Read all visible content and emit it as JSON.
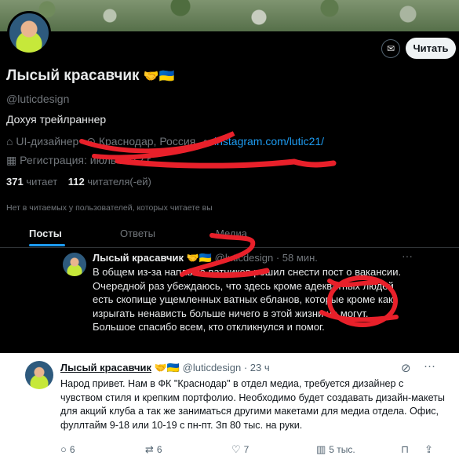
{
  "profile": {
    "name": "Лысый красавчик",
    "name_emoji": "🤝🇺🇦",
    "handle": "@luticdesign",
    "bio": "Дохуя трейлраннер",
    "profession": "UI-дизайнер",
    "location": "Краснодар, Россия",
    "link": "instagram.com/lutic21/",
    "registration": "Регистрация: июль 2012 г.",
    "following_count": "371",
    "following_label": "читает",
    "followers_count": "112",
    "followers_label": "читателя(-ей)",
    "no_mutuals_note": "Нет в читаемых у пользователей, которых читаете вы",
    "read_button": "Читать",
    "mail_icon": "mail-icon"
  },
  "tabs": [
    {
      "label": "Посты",
      "active": true
    },
    {
      "label": "Ответы",
      "active": false
    },
    {
      "label": "Медиа",
      "active": false
    }
  ],
  "dark_tweet": {
    "name": "Лысый красавчик",
    "emoji": "🤝🇺🇦",
    "handle_time": "@luticdesign · 58 мин.",
    "dots": "···",
    "text": "В общем из-за наплыва ватников решил снести пост о вакансии. Очередной раз убеждаюсь, что здесь кроме адекватных людей есть скопище ущемленных ватных ебланов, которые кроме как изрыгать ненависть больше ничего в этой жизни не могут. Большое спасибо всем, кто откликнулся и помог."
  },
  "light_tweet": {
    "name": "Лысый красавчик",
    "emoji": "🤝🇺🇦",
    "handle_time": "@luticdesign · 23 ч",
    "text": "Народ привет. Нам в ФК \"Краснодар\" в отдел медиа, требуется дизайнер с чувством стиля и крепким портфолио. Необходимо будет создавать дизайн-макеты для акций клуба а так же заниматься другими макетами для медиа отдела. Офис, фуллтайм 9-18 или 10-19 с пн-пт. Зп 80 тыс. на руки.",
    "replies": "6",
    "reposts": "6",
    "likes": "7",
    "views": "5 тыс."
  },
  "colors": {
    "dark_bg": "#000000",
    "accent": "#1d9bf0",
    "muted": "#71767b",
    "scribble": "#e8202a"
  }
}
